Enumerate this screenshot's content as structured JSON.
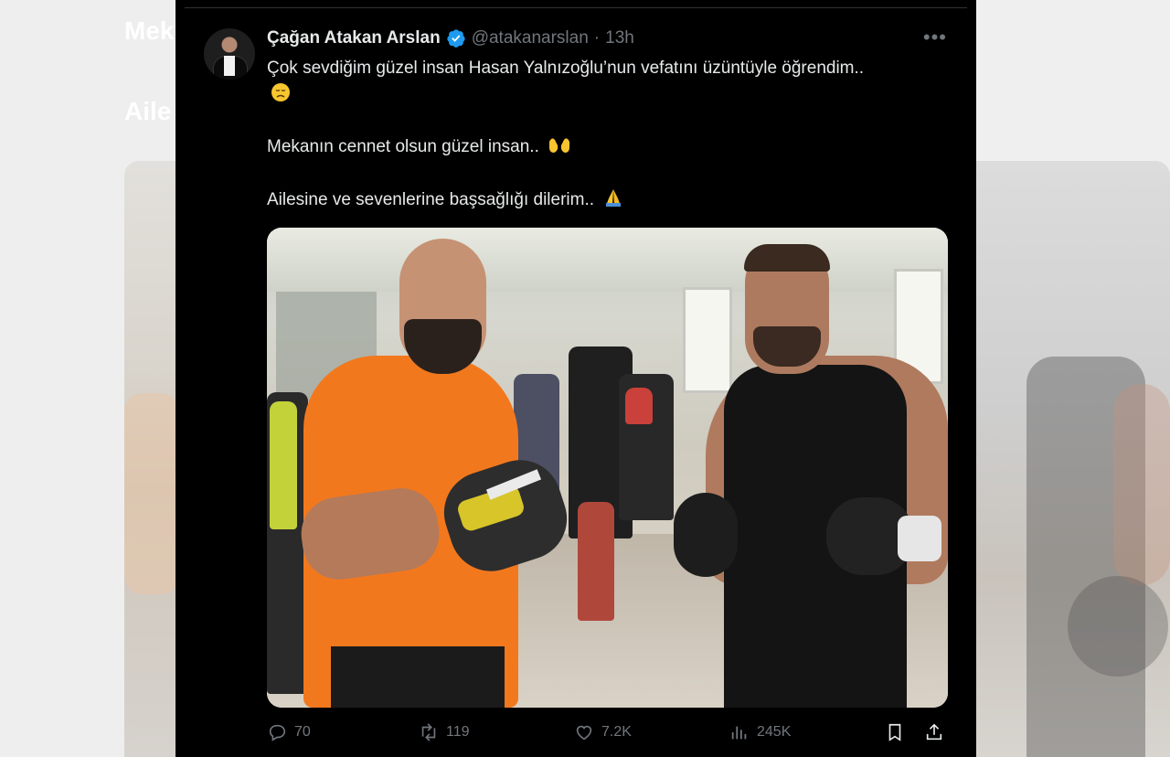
{
  "background": {
    "left_text_1": "Mek",
    "left_text_2": "Aile"
  },
  "tweet": {
    "author": {
      "display_name": "Çağan Atakan Arslan",
      "handle": "@atakanarslan",
      "verified": true
    },
    "separator": "·",
    "time": "13h",
    "more_label": "•••",
    "paragraphs": [
      "Çok sevdiğim güzel insan Hasan Yalnızoğlu’nun vefatını üzüntüyle öğrendim..",
      "Mekanın cennet olsun güzel insan..",
      "Ailesine ve sevenlerine başsağlığı dilerim.."
    ],
    "emojis": [
      "disappointed-face",
      "palms-up",
      "folded-hands"
    ],
    "media": {
      "description_icon": "photo"
    },
    "stats": {
      "replies": "70",
      "reposts": "119",
      "likes": "7.2K",
      "views": "245K"
    }
  },
  "colors": {
    "background": "#000000",
    "text": "#e7e9ea",
    "muted": "#71767b",
    "verified": "#1d9bf0"
  }
}
